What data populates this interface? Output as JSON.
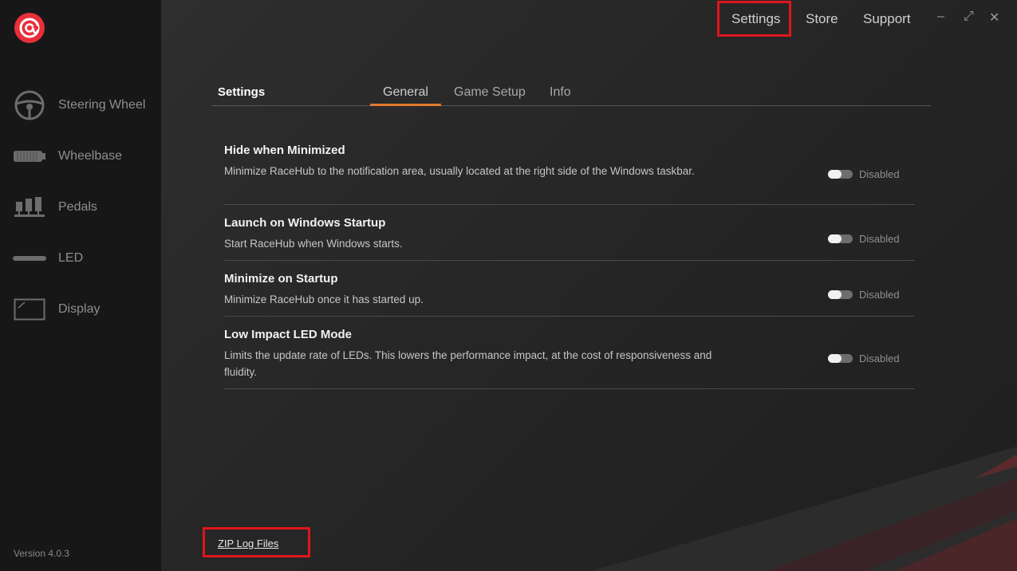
{
  "app": {
    "version": "Version 4.0.3"
  },
  "colors": {
    "accent": "#e07a2e",
    "highlight": "#e0151c",
    "logo": "#e8303a"
  },
  "sidebar": {
    "items": [
      {
        "label": "Steering Wheel",
        "icon": "steering-wheel-icon"
      },
      {
        "label": "Wheelbase",
        "icon": "wheelbase-icon"
      },
      {
        "label": "Pedals",
        "icon": "pedals-icon"
      },
      {
        "label": "LED",
        "icon": "led-bar-icon"
      },
      {
        "label": "Display",
        "icon": "display-icon"
      }
    ]
  },
  "topnav": {
    "settings": "Settings",
    "store": "Store",
    "support": "Support"
  },
  "window_controls": {
    "minimize": "–",
    "maximize": "⤢",
    "close": "✕"
  },
  "header": {
    "title": "Settings",
    "tabs": [
      {
        "label": "General",
        "active": true
      },
      {
        "label": "Game Setup",
        "active": false
      },
      {
        "label": "Info",
        "active": false
      }
    ]
  },
  "settings": [
    {
      "title": "Hide when Minimized",
      "desc": "Minimize RaceHub to the notification area, usually located at the right side of the Windows taskbar.",
      "state": "Disabled"
    },
    {
      "title": "Launch on Windows Startup",
      "desc": "Start RaceHub when Windows starts.",
      "state": "Disabled"
    },
    {
      "title": "Minimize on Startup",
      "desc": "Minimize RaceHub once it has started up.",
      "state": "Disabled"
    },
    {
      "title": "Low Impact LED Mode",
      "desc": "Limits the update rate of LEDs. This lowers the performance impact, at the cost of responsiveness and fluidity.",
      "state": "Disabled"
    }
  ],
  "footer": {
    "zip_log": "ZIP Log Files"
  }
}
